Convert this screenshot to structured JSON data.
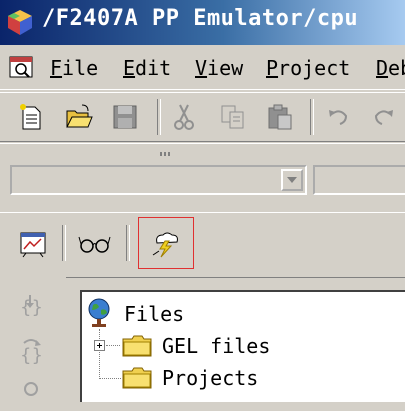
{
  "window": {
    "title": "/F2407A PP Emulator/cpu"
  },
  "menu": {
    "items": [
      {
        "underline": "F",
        "rest": "ile"
      },
      {
        "underline": "E",
        "rest": "dit"
      },
      {
        "underline": "V",
        "rest": "iew"
      },
      {
        "underline": "P",
        "rest": "roject"
      },
      {
        "underline": "D",
        "rest": "eb"
      }
    ]
  },
  "toolbar": {
    "buttons": [
      "new-file-icon",
      "open-folder-icon",
      "save-icon",
      "cut-icon",
      "copy-icon",
      "paste-icon",
      "undo-icon",
      "redo-icon"
    ]
  },
  "combos": {
    "left_value": "",
    "right_value": ""
  },
  "toolbar3": {
    "buttons": [
      "chart-icon",
      "watch-glasses-icon",
      "lightning-cloud-icon"
    ],
    "highlighted": "lightning-cloud-icon"
  },
  "project_tree": {
    "root_label": "Files",
    "children": [
      "GEL files",
      "Projects"
    ]
  }
}
